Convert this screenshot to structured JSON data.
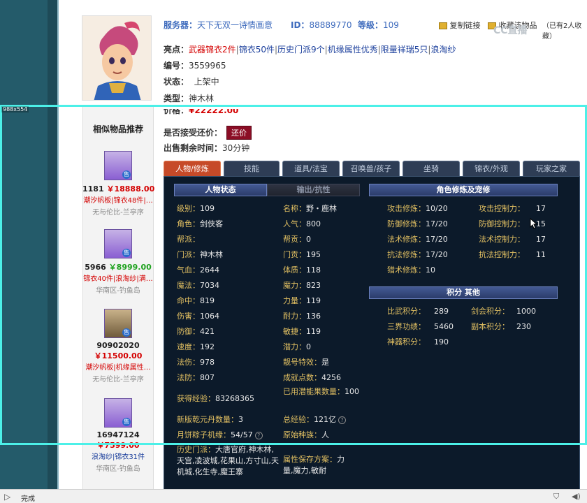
{
  "header": {
    "server_label": "服务器：",
    "server_value": "天下无双一诗情画意",
    "id_label": "ID：",
    "id_value": "88889770",
    "level_label": "等级：",
    "level_value": "109",
    "copy_link": "复制链接",
    "collect_link": "收藏该物品",
    "collect_count": "（已有2人收藏）",
    "watermark": "CC直播"
  },
  "item": {
    "highlight_label": "亮点：",
    "highlights": [
      "武器锦衣2件",
      "锦衣50件",
      "历史门派9个",
      "机缘属性优秀",
      "限量祥瑞5只",
      "浪淘纱"
    ],
    "code_label": "编号：",
    "code_value": "3559965",
    "status_label": "状态：",
    "status_value": "上架中",
    "type_label": "类型：",
    "type_value": "神木林",
    "price_label": "价格：",
    "price_value": "¥22222.00",
    "bargain_label": "是否接受还价：",
    "bargain_button": "还价",
    "time_label": "出售剩余时间：",
    "time_value": "30分钟"
  },
  "similar": {
    "title": "相似物品推荐",
    "items": [
      {
        "id": "1181",
        "price": "￥18888.00",
        "tags": "潮汐帆板|锦衣48件|…",
        "region": "无与伦比-兰亭序",
        "color": "red"
      },
      {
        "id": "5966",
        "price": "￥8999.00",
        "tags": "锦衣40件|浪淘纱|满…",
        "region": "华南区-钓鱼岛",
        "color": "green"
      },
      {
        "id": "90902020",
        "price": "￥11500.00",
        "tags": "潮汐帆板|机缘属性…",
        "region": "无与伦比-兰亭序",
        "color": "red"
      },
      {
        "id": "16947124",
        "price": "￥7599.00",
        "tags": "浪淘纱|锦衣31件",
        "region": "华南区-钓鱼岛",
        "color": "red"
      }
    ],
    "sell_badge": "售"
  },
  "tabs": [
    "人物/修炼",
    "技能",
    "道具/法宝",
    "召唤兽/孩子",
    "坐骑",
    "锦衣/外观",
    "玩家之家"
  ],
  "sections": {
    "char_status": "人物状态",
    "output_resist": "输出/抗性",
    "cultivation": "角色修炼及宠修",
    "points": "积分 其他"
  },
  "stats_left": [
    {
      "k": "级别：",
      "v": "109"
    },
    {
      "k": "角色：",
      "v": "剑侠客"
    },
    {
      "k": "帮派：",
      "v": ""
    },
    {
      "k": "门派：",
      "v": "神木林"
    },
    {
      "k": "气血：",
      "v": "2644"
    },
    {
      "k": "魔法：",
      "v": "7034"
    },
    {
      "k": "命中：",
      "v": "819"
    },
    {
      "k": "伤害：",
      "v": "1064"
    },
    {
      "k": "防御：",
      "v": "421"
    },
    {
      "k": "速度：",
      "v": "192"
    },
    {
      "k": "法伤：",
      "v": "978"
    },
    {
      "k": "法防：",
      "v": "807"
    }
  ],
  "stats_right": [
    {
      "k": "名称：",
      "v": "野・鹿林"
    },
    {
      "k": "人气：",
      "v": "800"
    },
    {
      "k": "帮贡：",
      "v": "0"
    },
    {
      "k": "门贡：",
      "v": "195"
    },
    {
      "k": "体质：",
      "v": "118"
    },
    {
      "k": "魔力：",
      "v": "823"
    },
    {
      "k": "力量：",
      "v": "119"
    },
    {
      "k": "耐力：",
      "v": "136"
    },
    {
      "k": "敏捷：",
      "v": "119"
    },
    {
      "k": "潜力：",
      "v": "0"
    },
    {
      "k": "靓号特效：",
      "v": "是"
    },
    {
      "k": "成就点数：",
      "v": "4256"
    }
  ],
  "stats_bottom": {
    "exp_label": "获得经验：",
    "exp_value": "83268365",
    "potential_label": "已用潜能果数量：",
    "potential_value": "100",
    "qiankun_label": "新版乾元丹数量：",
    "qiankun_value": "3",
    "total_exp_label": "总经验：",
    "total_exp_value": "121亿",
    "zongzi_label": "月饼粽子机缘：",
    "zongzi_value": "54/57",
    "race_label": "原始种族：",
    "race_value": "人",
    "history_label": "历史门派：",
    "history_value": "大唐官府,神木林,天宫,凌波城,花果山,方寸山,天机城,化生寺,魔王寨",
    "attr_label": "属性保存方案：",
    "attr_value": "力量,魔力,敏耐"
  },
  "cultivation": [
    {
      "k1": "攻击修炼：",
      "v1": "10/20",
      "k2": "攻击控制力：",
      "v2": "17"
    },
    {
      "k1": "防御修炼：",
      "v1": "17/20",
      "k2": "防御控制力：",
      "v2": "15"
    },
    {
      "k1": "法术修炼：",
      "v1": "17/20",
      "k2": "法术控制力：",
      "v2": "17"
    },
    {
      "k1": "抗法修炼：",
      "v1": "17/20",
      "k2": "抗法控制力：",
      "v2": "11"
    },
    {
      "k1": "猎术修炼：",
      "v1": "10",
      "k2": "",
      "v2": ""
    }
  ],
  "points": [
    {
      "k1": "比武积分：",
      "v1": "289",
      "k2": "剑会积分：",
      "v2": "1000"
    },
    {
      "k1": "三界功绩：",
      "v1": "5460",
      "k2": "副本积分：",
      "v2": "230"
    },
    {
      "k1": "神器积分：",
      "v1": "190",
      "k2": "",
      "v2": ""
    }
  ],
  "overlay_label": "988x554",
  "statusbar": {
    "text": "完成"
  }
}
